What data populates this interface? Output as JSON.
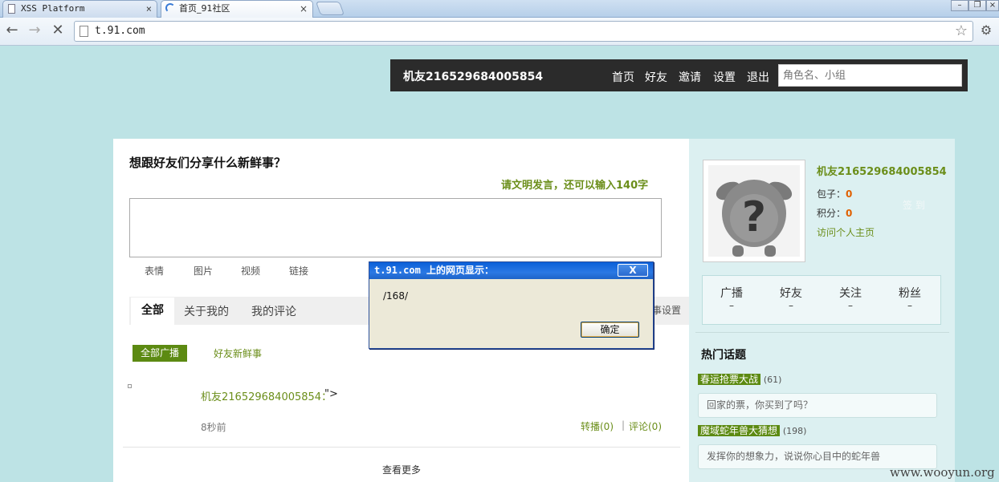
{
  "browser": {
    "tabs": [
      {
        "label": "XSS Platform",
        "close": "×"
      },
      {
        "label": "首页_91社区",
        "close": "×"
      }
    ],
    "url": "t.91.com"
  },
  "topbar": {
    "username": "机友216529684005854",
    "nav": [
      "首页",
      "好友",
      "邀请",
      "设置",
      "退出"
    ],
    "search_placeholder": "角色名、小组"
  },
  "composer": {
    "heading": "想跟好友们分享什么新鲜事？",
    "hint": "请文明发言，还可以输入140字",
    "tools": [
      "表情",
      "图片",
      "视频",
      "链接"
    ]
  },
  "feed": {
    "tabs": [
      "全部",
      "关于我的",
      "我的评论"
    ],
    "settings_label": "事设置",
    "filter_all": "全部广播",
    "filter_friends": "好友新鲜事",
    "post": {
      "author": "机友216529684005854：",
      "content": "\">",
      "time": "8秒前",
      "repost": "转播(0)",
      "separator": "|",
      "comment": "评论(0)"
    },
    "more": "查看更多"
  },
  "profile": {
    "name": "机友216529684005854",
    "bao_label": "包子：",
    "bao_value": "0",
    "score_label": "积分：",
    "score_value": "0",
    "visit": "访问个人主页",
    "faint": "签 到",
    "stats": [
      {
        "label": "广播",
        "value": "–"
      },
      {
        "label": "好友",
        "value": "–"
      },
      {
        "label": "关注",
        "value": "–"
      },
      {
        "label": "粉丝",
        "value": "–"
      }
    ]
  },
  "hot_topics": {
    "heading": "热门话题",
    "items": [
      {
        "title": "春运抢票大战",
        "count": "(61)",
        "desc": "回家的票，你买到了吗？"
      },
      {
        "title": "魔域蛇年兽大猜想",
        "count": "(198)",
        "desc": "发挥你的想象力，说说你心目中的蛇年兽"
      }
    ]
  },
  "dialog": {
    "title": "t.91.com 上的网页显示：",
    "close": "X",
    "message": "/168/",
    "ok": "确定"
  },
  "watermark": "www.wooyun.org",
  "colors": {
    "accent": "#6b8e1a",
    "page_bg": "#bde3e5",
    "topbar": "#2b2b2b"
  }
}
